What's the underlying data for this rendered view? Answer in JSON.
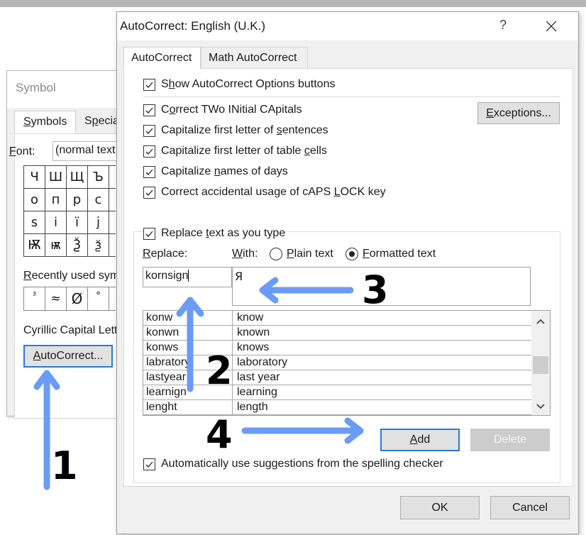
{
  "symbol_dialog": {
    "title": "Symbol",
    "tabs": [
      {
        "label": "Symbols",
        "accel": "S",
        "active": true
      },
      {
        "label": "Special",
        "accel": "p",
        "active": false
      }
    ],
    "font_label": "Font:",
    "font_value": "(normal text",
    "symbol_grid": [
      [
        "Ч",
        "Ш",
        "Щ",
        "Ъ"
      ],
      [
        "о",
        "п",
        "р",
        "с"
      ],
      [
        "ѕ",
        "і",
        "ї",
        "ј"
      ],
      [
        "Ѭ",
        "ѭ",
        "Ѯ",
        "ѯ"
      ]
    ],
    "recent_label": "Recently used sym",
    "recent_symbols": [
      "³",
      "≈",
      "Ø",
      "°"
    ],
    "char_name": "Cyrillic Capital Lett",
    "autocorrect_button": "AutoCorrect..."
  },
  "autocorrect_dialog": {
    "title": "AutoCorrect: English (U.K.)",
    "help_label": "?",
    "tabs": [
      {
        "label": "AutoCorrect",
        "active": true
      },
      {
        "label": "Math AutoCorrect",
        "active": false
      }
    ],
    "show_options": {
      "label": "Show AutoCorrect Options buttons",
      "checked": true
    },
    "options": [
      {
        "label": "Correct TWo INitial CApitals",
        "checked": true
      },
      {
        "label": "Capitalize first letter of sentences",
        "checked": true
      },
      {
        "label": "Capitalize first letter of table cells",
        "checked": true
      },
      {
        "label": "Capitalize names of days",
        "checked": true
      },
      {
        "label": "Correct accidental usage of cAPS LOCK key",
        "checked": true
      }
    ],
    "exceptions_button": "Exceptions...",
    "replace_as_you_type": {
      "label": "Replace text as you type",
      "checked": true
    },
    "replace_label": "Replace:",
    "with_label": "With:",
    "radio_plain": {
      "label": "Plain text",
      "selected": false
    },
    "radio_formatted": {
      "label": "Formatted text",
      "selected": true
    },
    "replace_value": "kornsign",
    "with_value": "Я",
    "entries": [
      {
        "replace": "konw",
        "with": "know"
      },
      {
        "replace": "konwn",
        "with": "known"
      },
      {
        "replace": "konws",
        "with": "knows"
      },
      {
        "replace": "labratory",
        "with": "laboratory"
      },
      {
        "replace": "lastyear",
        "with": "last year"
      },
      {
        "replace": "learnign",
        "with": "learning"
      },
      {
        "replace": "lenght",
        "with": "length"
      }
    ],
    "add_button": "Add",
    "delete_button": "Delete",
    "auto_suggestions": {
      "label": "Automatically use suggestions from the spelling checker",
      "checked": true
    },
    "ok_button": "OK",
    "cancel_button": "Cancel"
  },
  "annotations": {
    "step1": "1",
    "step2": "2",
    "step3": "3",
    "step4": "4",
    "arrow_color": "#6b9cf5"
  }
}
